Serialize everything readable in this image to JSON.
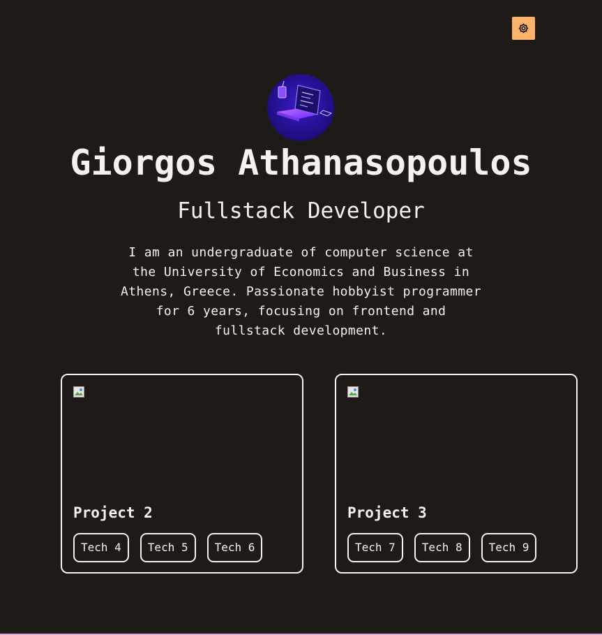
{
  "header": {
    "theme_toggle_icon": "gear-icon",
    "accent": "#fbb36b"
  },
  "profile": {
    "avatar_icon": "laptop-illustration",
    "name": "Giorgos Athanasopoulos",
    "role": "Fullstack Developer",
    "bio": "I am an undergraduate of computer science at the University of Economics and Business in Athens, Greece. Passionate hobbyist programmer for 6 years, focusing on frontend and fullstack development."
  },
  "projects": [
    {
      "title": "Project 2",
      "tags": [
        "Tech 4",
        "Tech 5",
        "Tech 6"
      ]
    },
    {
      "title": "Project 3",
      "tags": [
        "Tech 7",
        "Tech 8",
        "Tech 9"
      ]
    }
  ]
}
